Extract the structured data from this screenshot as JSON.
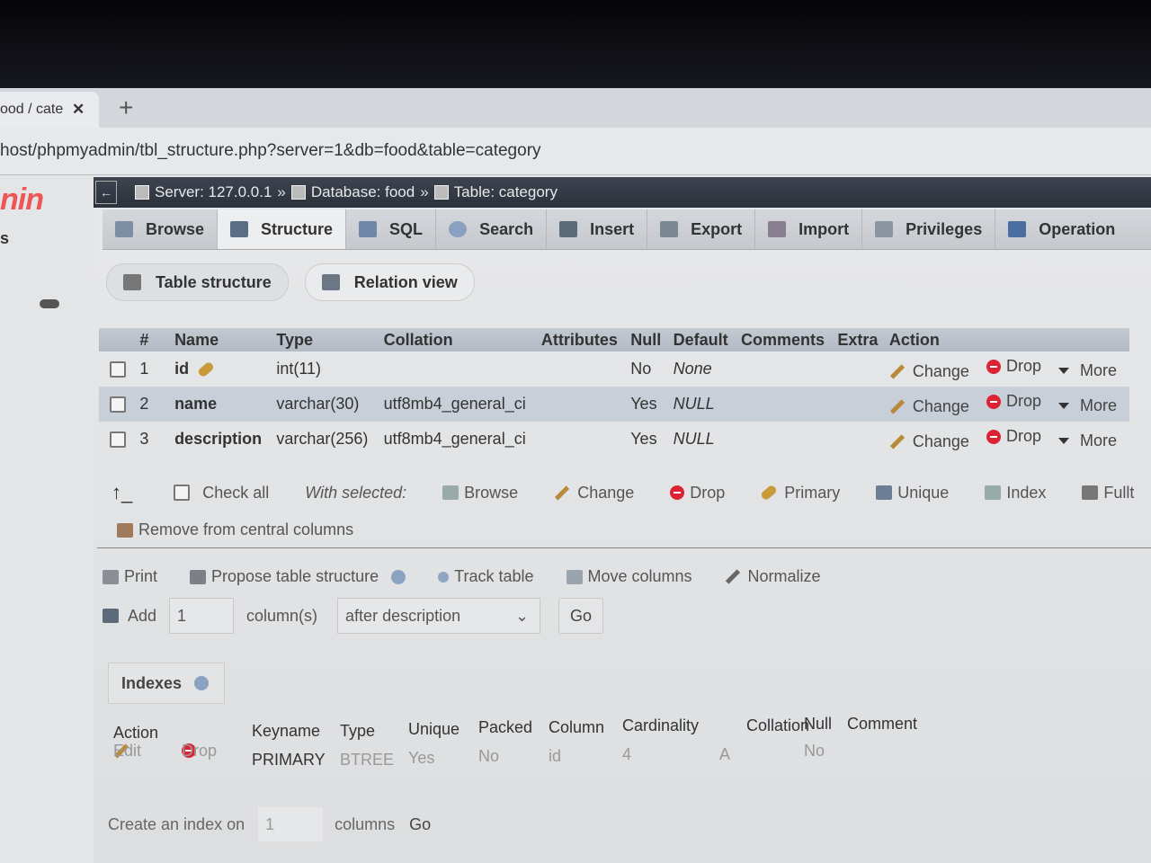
{
  "browser": {
    "tab_title": "ood / cate",
    "url": "host/phpmyadmin/tbl_structure.php?server=1&db=food&table=category"
  },
  "left": {
    "logo": "nin"
  },
  "breadcrumb": {
    "server": "Server: 127.0.0.1",
    "database": "Database: food",
    "table": "Table: category",
    "sep": "»"
  },
  "tabs": [
    {
      "label": "Browse"
    },
    {
      "label": "Structure"
    },
    {
      "label": "SQL"
    },
    {
      "label": "Search"
    },
    {
      "label": "Insert"
    },
    {
      "label": "Export"
    },
    {
      "label": "Import"
    },
    {
      "label": "Privileges"
    },
    {
      "label": "Operation"
    }
  ],
  "subtabs": {
    "table_structure": "Table structure",
    "relation_view": "Relation view"
  },
  "table": {
    "headers": [
      "#",
      "Name",
      "Type",
      "Collation",
      "Attributes",
      "Null",
      "Default",
      "Comments",
      "Extra",
      "Action"
    ],
    "rows": [
      {
        "num": "1",
        "name": "id",
        "type": "int(11)",
        "collation": "",
        "null": "No",
        "default": "None"
      },
      {
        "num": "2",
        "name": "name",
        "type": "varchar(30)",
        "collation": "utf8mb4_general_ci",
        "null": "Yes",
        "default": "NULL"
      },
      {
        "num": "3",
        "name": "description",
        "type": "varchar(256)",
        "collation": "utf8mb4_general_ci",
        "null": "Yes",
        "default": "NULL"
      }
    ],
    "actions": {
      "change": "Change",
      "drop": "Drop",
      "more": "More"
    }
  },
  "with_selected": {
    "check_all": "Check all",
    "label": "With selected:",
    "browse": "Browse",
    "change": "Change",
    "drop": "Drop",
    "primary": "Primary",
    "unique": "Unique",
    "index": "Index",
    "fulltext": "Fullt",
    "remove": "Remove from central columns"
  },
  "tools": {
    "print": "Print",
    "propose": "Propose table structure",
    "track": "Track table",
    "move": "Move columns",
    "normalize": "Normalize"
  },
  "add": {
    "label": "Add",
    "count": "1",
    "columns": "column(s)",
    "position": "after description",
    "go": "Go"
  },
  "indexes": {
    "title": "Indexes",
    "headers": [
      "Action",
      "Keyname",
      "Type",
      "Unique",
      "Packed",
      "Column",
      "Cardinality",
      "Collation",
      "Null",
      "Comment"
    ],
    "row": {
      "edit": "Edit",
      "drop": "Drop",
      "keyname": "PRIMARY",
      "type": "BTREE",
      "unique": "Yes",
      "packed": "No",
      "column": "id",
      "cardinality": "4",
      "collation": "A",
      "null": "No"
    },
    "create_label": "Create an index on",
    "create_count": "1",
    "create_columns": "columns",
    "create_go": "Go"
  }
}
